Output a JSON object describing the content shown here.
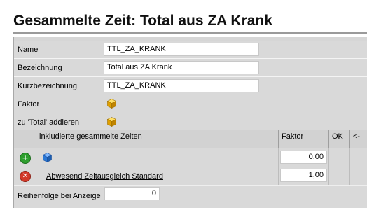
{
  "header": {
    "title": "Gesammelte Zeit: Total aus ZA Krank"
  },
  "form": {
    "name_label": "Name",
    "name_value": "TTL_ZA_KRANK",
    "bezeichnung_label": "Bezeichnung",
    "bezeichnung_value": "Total aus ZA Krank",
    "kurz_label": "Kurzbezeichnung",
    "kurz_value": "TTL_ZA_KRANK",
    "faktor_label": "Faktor",
    "total_label": "zu 'Total' addieren",
    "reihenfolge_label": "Reihenfolge bei Anzeige",
    "reihenfolge_value": "0"
  },
  "grid": {
    "columns": [
      "inkludierte gesammelte Zeiten",
      "Faktor",
      "OK",
      "<-"
    ],
    "rows": [
      {
        "action_icon": "add-icon",
        "item_icon": "blue-cube-icon",
        "name": "",
        "faktor": "0,00"
      },
      {
        "action_icon": "delete-icon",
        "name": "Abwesend Zeitausgleich  Standard",
        "faktor": "1,00"
      }
    ]
  },
  "colors": {
    "panel_bg": "#d9d9d9",
    "add_green": "#2e9e2e",
    "delete_red": "#d23a2a",
    "cube_yellow": "#f0b400",
    "cube_blue": "#2a78d6"
  }
}
